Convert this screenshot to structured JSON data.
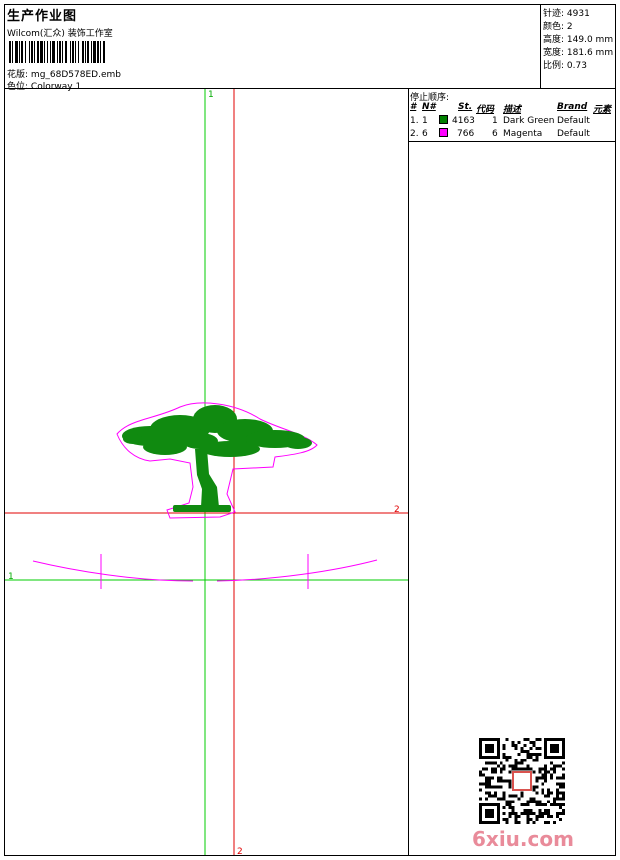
{
  "header": {
    "title": "生产作业图",
    "subtitle": "Wilcom(汇众) 装饰工作室",
    "design_label": "花版:",
    "design_file": "mg_68D578ED.emb",
    "colorway_label": "色位:",
    "colorway": "Colorway 1"
  },
  "stats": [
    {
      "label": "针迹:",
      "value": "4931"
    },
    {
      "label": "颜色:",
      "value": "2"
    },
    {
      "label": "高度:",
      "value": "149.0 mm"
    },
    {
      "label": "宽度:",
      "value": "181.6 mm"
    },
    {
      "label": "比例:",
      "value": "0.73"
    }
  ],
  "stop_sequence": {
    "title": "停止顺序:",
    "headers": {
      "num": "#",
      "n": "N#",
      "st": "St.",
      "code": "代码",
      "desc": "描述",
      "brand": "Brand",
      "element": "元素"
    },
    "rows": [
      {
        "num": "1.",
        "n": "1",
        "color": "#008000",
        "st": "4163",
        "code": "1",
        "desc": "Dark Green",
        "brand": "Default"
      },
      {
        "num": "2.",
        "n": "6",
        "color": "#ff00ff",
        "st": "766",
        "code": "6",
        "desc": "Magenta",
        "brand": "Default"
      }
    ]
  },
  "guides": {
    "v_green_label": "1",
    "h_red_label": "2",
    "h_green_label": "1",
    "v_red_label": "2"
  },
  "watermark": "6xiu.com"
}
